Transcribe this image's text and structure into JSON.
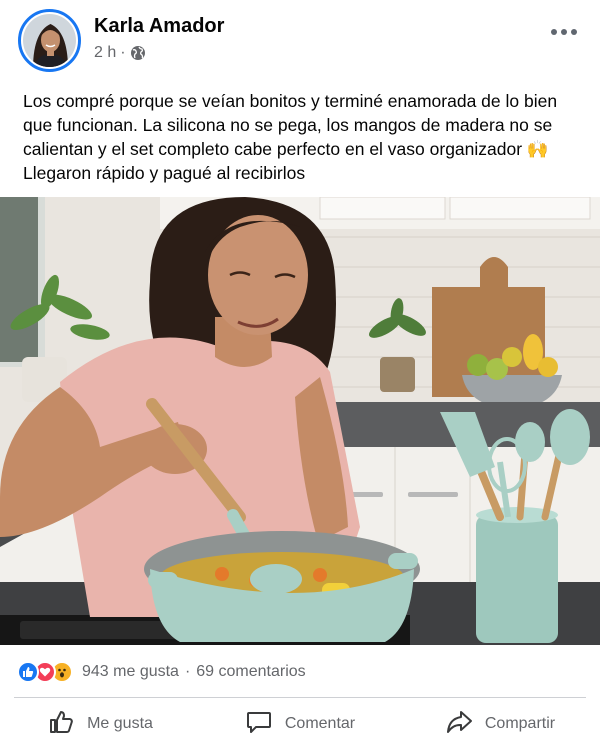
{
  "post": {
    "author": "Karla Amador",
    "time": "2 h",
    "separator": "·",
    "privacy_icon": "globe-icon",
    "more_icon": "more-options-icon",
    "text_lines": [
      "Los compré porque se veían bonitos y terminé enamorada de lo bien",
      "que funcionan. La silicona no se pega, los mangos de madera no se",
      "calientan y el set completo cabe perfecto en el vaso organizador 🙌",
      "Llegaron rápido y pagué al recibirlos"
    ],
    "photo_icon": "post-photo"
  },
  "reactions": {
    "icons": [
      "like-reaction-icon",
      "love-reaction-icon",
      "wow-reaction-icon"
    ],
    "likes": "943 me gusta",
    "dot": "·",
    "comments": "69 comentarios"
  },
  "actions": {
    "like": "Me gusta",
    "comment": "Comentar",
    "share": "Compartir"
  },
  "colors": {
    "accent": "#1877f2",
    "love": "#f33e58",
    "wow": "#f7b125",
    "muted": "#65676b",
    "utensil_mint": "#a9cfc5"
  }
}
